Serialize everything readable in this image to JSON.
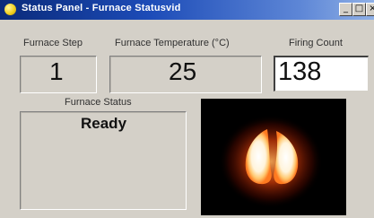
{
  "window": {
    "title": "Status Panel - Furnace Statusvid",
    "controls": {
      "minimize": "_",
      "maximize": "□",
      "close": "×"
    }
  },
  "furnace_step": {
    "label": "Furnace Step",
    "value": "1"
  },
  "furnace_temperature": {
    "label": "Furnace Temperature  (°C)",
    "value": "25"
  },
  "firing_count": {
    "label": "Firing Count",
    "value": "138"
  },
  "furnace_status": {
    "label": "Furnace Status",
    "value": "Ready"
  },
  "colors": {
    "title_bar_start": "#0a2a7a",
    "title_bar_end": "#8fb0e6",
    "window_bg": "#d4d0c8",
    "glow_inner": "#ffffff",
    "glow_mid": "#ffcc66",
    "glow_outer": "#cc2200"
  },
  "icons": {
    "title": "app-circle-icon",
    "camera": "furnace-camera-view"
  }
}
